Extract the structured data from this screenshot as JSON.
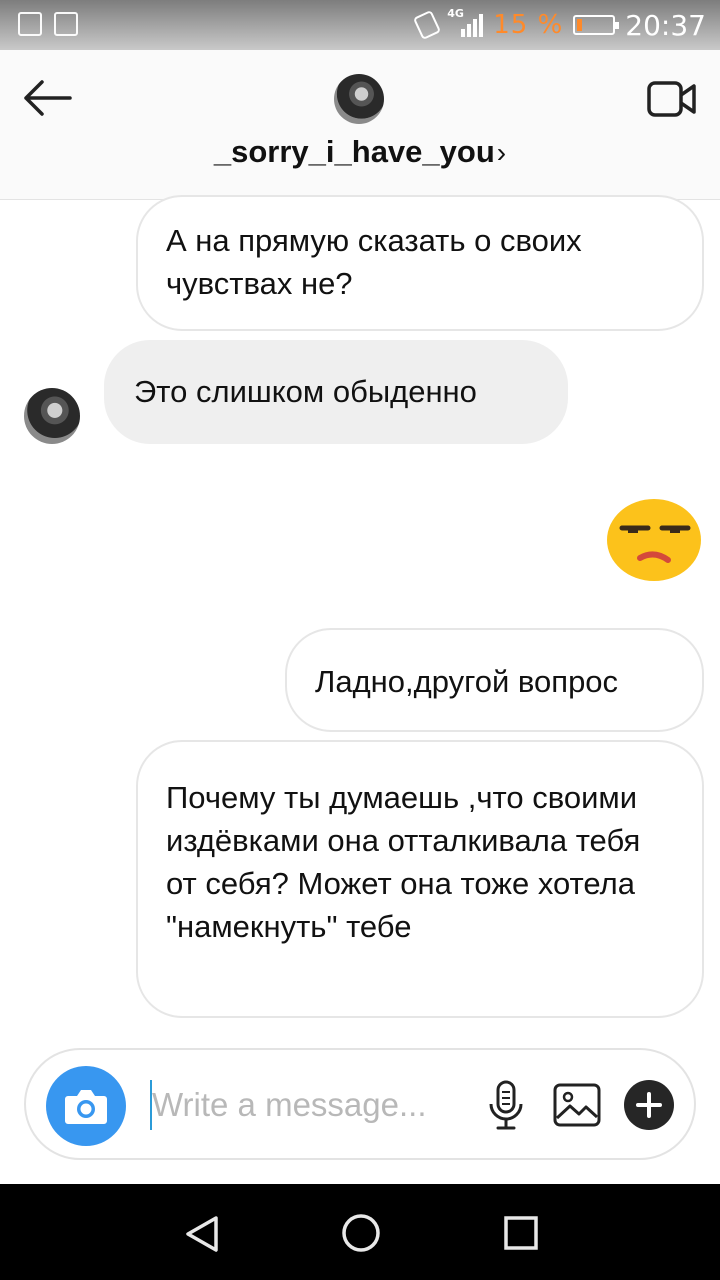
{
  "status_bar": {
    "battery_percent": "15 %",
    "time": "20:37",
    "network": "4G",
    "battery_color": "#ff8a2a"
  },
  "header": {
    "username": "_sorry_i_have_you",
    "chevron": "›",
    "back_icon": "arrow-left-icon",
    "video_icon": "video-call-icon"
  },
  "messages": [
    {
      "direction": "outgoing",
      "text": "А на прямую сказать о своих чувствах не?"
    },
    {
      "direction": "incoming",
      "text": "Это слишком обыденно"
    },
    {
      "direction": "outgoing",
      "type": "emoji",
      "emoji": "unamused-face"
    },
    {
      "direction": "outgoing",
      "text": "Ладно,другой вопрос"
    },
    {
      "direction": "outgoing",
      "text": "Почему ты думаешь ,что своими издёвками она отталкивала тебя от себя? Может она тоже хотела \"намекнуть\" тебе"
    }
  ],
  "composer": {
    "placeholder": "Write a message...",
    "value": "",
    "accent_color": "#3897f0"
  },
  "nav_bar": {
    "icons": [
      "back-triangle-icon",
      "home-circle-icon",
      "recents-square-icon"
    ]
  }
}
